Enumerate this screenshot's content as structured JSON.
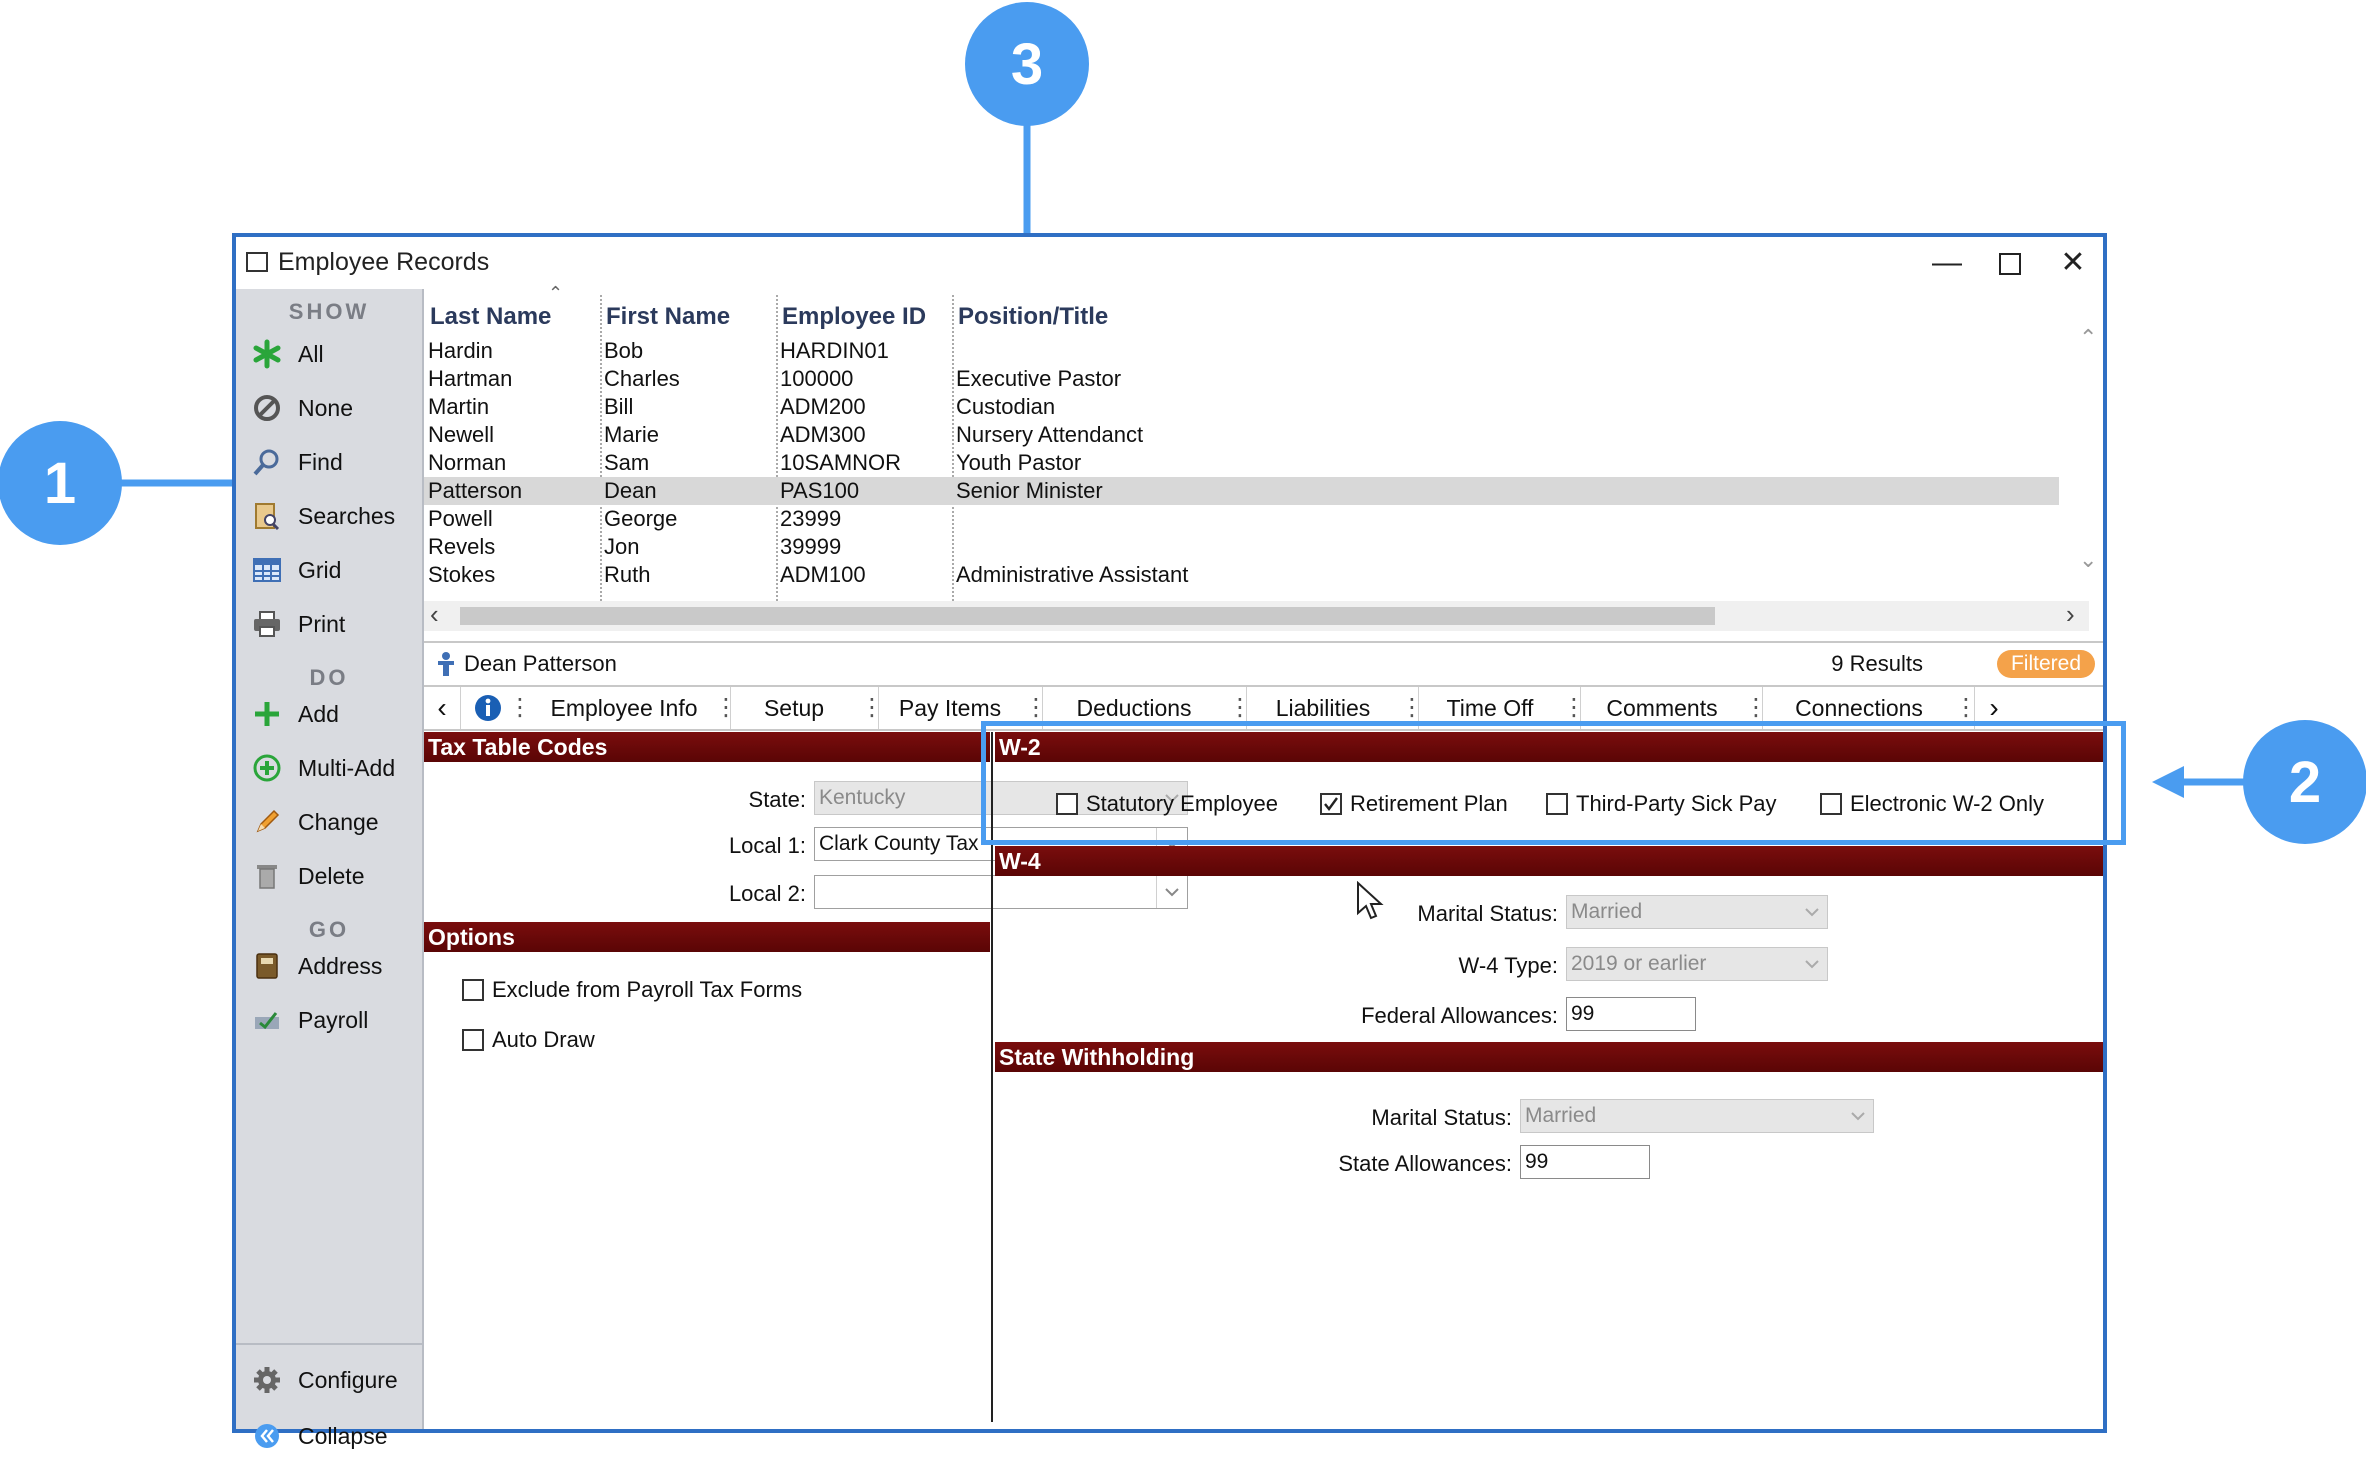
{
  "window": {
    "title": "Employee Records"
  },
  "sidebar": {
    "show_heading": "SHOW",
    "show_items": [
      {
        "label": "All",
        "icon": "asterisk-icon"
      },
      {
        "label": "None",
        "icon": "none-icon"
      },
      {
        "label": "Find",
        "icon": "magnifier-icon"
      },
      {
        "label": "Searches",
        "icon": "searches-icon"
      },
      {
        "label": "Grid",
        "icon": "grid-icon"
      },
      {
        "label": "Print",
        "icon": "printer-icon"
      }
    ],
    "do_heading": "DO",
    "do_items": [
      {
        "label": "Add",
        "icon": "plus-icon"
      },
      {
        "label": "Multi-Add",
        "icon": "multi-add-icon"
      },
      {
        "label": "Change",
        "icon": "pencil-icon"
      },
      {
        "label": "Delete",
        "icon": "trash-icon"
      }
    ],
    "go_heading": "GO",
    "go_items": [
      {
        "label": "Address",
        "icon": "address-book-icon"
      },
      {
        "label": "Payroll",
        "icon": "payroll-icon"
      }
    ],
    "bottom_items": [
      {
        "label": "Configure",
        "icon": "gear-icon"
      },
      {
        "label": "Collapse",
        "icon": "collapse-icon"
      }
    ]
  },
  "grid": {
    "columns": [
      "Last Name",
      "First Name",
      "Employee ID",
      "Position/Title"
    ],
    "rows": [
      [
        "Hardin",
        "Bob",
        "HARDIN01",
        ""
      ],
      [
        "Hartman",
        "Charles",
        "100000",
        "Executive Pastor"
      ],
      [
        "Martin",
        "Bill",
        "ADM200",
        "Custodian"
      ],
      [
        "Newell",
        "Marie",
        "ADM300",
        "Nursery Attendanct"
      ],
      [
        "Norman",
        "Sam",
        "10SAMNOR",
        "Youth Pastor"
      ],
      [
        "Patterson",
        "Dean",
        "PAS100",
        "Senior Minister"
      ],
      [
        "Powell",
        "George",
        "23999",
        ""
      ],
      [
        "Revels",
        "Jon",
        "39999",
        ""
      ],
      [
        "Stokes",
        "Ruth",
        "ADM100",
        "Administrative Assistant"
      ]
    ],
    "selected_row": 5
  },
  "status": {
    "employee": "Dean Patterson",
    "results": "9 Results",
    "filter_badge": "Filtered"
  },
  "tabs": [
    "Employee Info",
    "Setup",
    "Pay Items",
    "Deductions",
    "Liabilities",
    "Time Off",
    "Comments",
    "Connections"
  ],
  "tax_table": {
    "heading": "Tax Table Codes",
    "state_label": "State:",
    "state_value": "Kentucky",
    "local1_label": "Local 1:",
    "local1_value": "Clark County Tax",
    "local2_label": "Local 2:",
    "local2_value": ""
  },
  "options": {
    "heading": "Options",
    "exclude_label": "Exclude from Payroll Tax Forms",
    "exclude_checked": false,
    "autodraw_label": "Auto Draw",
    "autodraw_checked": false
  },
  "w2": {
    "heading": "W-2",
    "items": [
      {
        "label": "Statutory Employee",
        "checked": false
      },
      {
        "label": "Retirement Plan",
        "checked": true
      },
      {
        "label": "Third-Party Sick Pay",
        "checked": false
      },
      {
        "label": "Electronic W-2 Only",
        "checked": false
      }
    ]
  },
  "w4": {
    "heading": "W-4",
    "marital_label": "Marital Status:",
    "marital_value": "Married",
    "type_label": "W-4 Type:",
    "type_value": "2019 or earlier",
    "allow_label": "Federal Allowances:",
    "allow_value": "99"
  },
  "state_wh": {
    "heading": "State Withholding",
    "marital_label": "Marital Status:",
    "marital_value": "Married",
    "allow_label": "State Allowances:",
    "allow_value": "99"
  },
  "callouts": [
    "1",
    "2",
    "3"
  ],
  "colors": {
    "accent": "#4a9cf0",
    "section": "#6a0808",
    "badge": "#f4a24a",
    "window_border": "#2f6fc4"
  }
}
